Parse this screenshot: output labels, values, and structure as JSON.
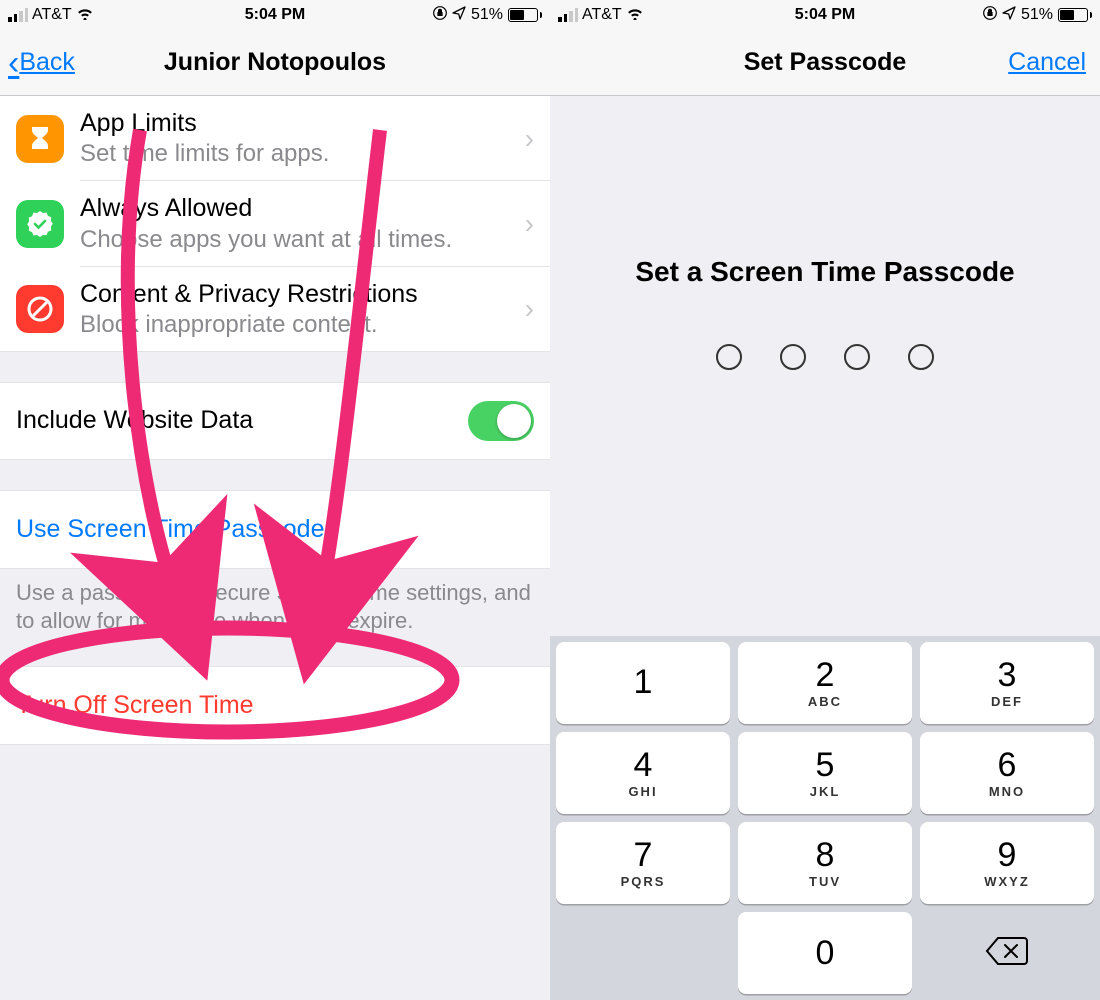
{
  "status": {
    "carrier": "AT&T",
    "time": "5:04 PM",
    "battery_pct": "51%"
  },
  "left": {
    "back_label": "Back",
    "title": "Junior Notopoulos",
    "items": [
      {
        "title": "App Limits",
        "subtitle": "Set time limits for apps."
      },
      {
        "title": "Always Allowed",
        "subtitle": "Choose apps you want at all times."
      },
      {
        "title": "Content & Privacy Restrictions",
        "subtitle": "Block inappropriate content."
      }
    ],
    "website_data_label": "Include Website Data",
    "website_data_on": true,
    "use_passcode_label": "Use Screen Time Passcode",
    "passcode_footer": "Use a passcode to secure Screen Time settings, and to allow for more time when limits expire.",
    "turn_off_label": "Turn Off Screen Time"
  },
  "right": {
    "title": "Set Passcode",
    "cancel_label": "Cancel",
    "prompt": "Set a Screen Time Passcode",
    "keypad": [
      {
        "num": "1",
        "letters": ""
      },
      {
        "num": "2",
        "letters": "ABC"
      },
      {
        "num": "3",
        "letters": "DEF"
      },
      {
        "num": "4",
        "letters": "GHI"
      },
      {
        "num": "5",
        "letters": "JKL"
      },
      {
        "num": "6",
        "letters": "MNO"
      },
      {
        "num": "7",
        "letters": "PQRS"
      },
      {
        "num": "8",
        "letters": "TUV"
      },
      {
        "num": "9",
        "letters": "WXYZ"
      },
      {
        "num": "0",
        "letters": ""
      }
    ]
  },
  "annotation_color": "#ef2a74"
}
